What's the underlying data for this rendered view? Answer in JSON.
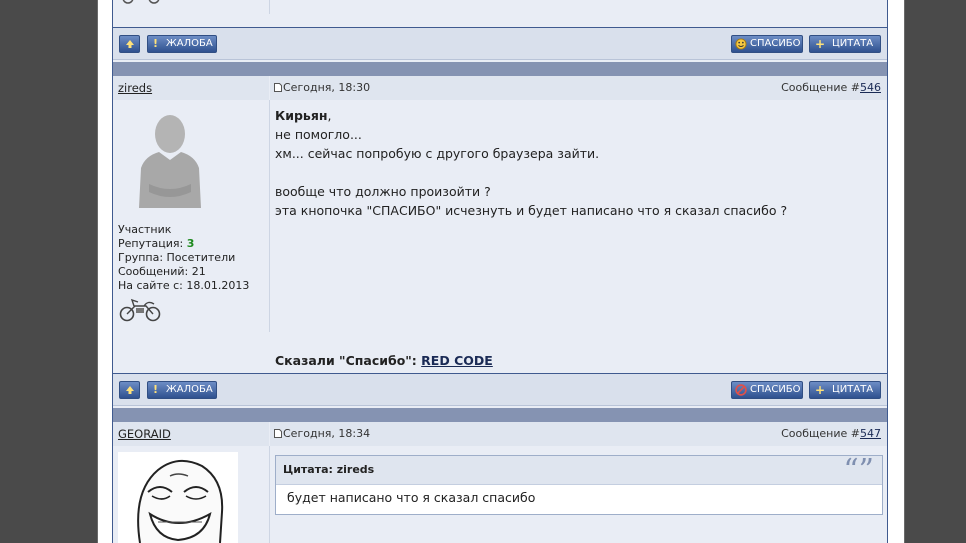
{
  "toolbar_top": {
    "up_label": "",
    "report_label": "ЖАЛОБА",
    "thanks_label": "СПАСИБО",
    "quote_label": "ЦИТАТА"
  },
  "post546": {
    "username": "zireds",
    "date": "Сегодня, 18:30",
    "number_prefix": "Сообщение #",
    "number": "546",
    "addressee": "Кирьян",
    "lines": [
      "не помогло...",
      "хм... сейчас попробую с другого браузера зайти.",
      "",
      "вообще что должно произойти ?",
      "эта кнопочка \"СПАСИБО\" исчезнуть и будет написано что я сказал спасибо ?"
    ],
    "user_info": {
      "role": "Участник",
      "reputation_label": "Репутация: ",
      "reputation_value": "3",
      "group": "Группа: Посетители",
      "messages": "Сообщений: 21",
      "joined": "На сайте с: 18.01.2013"
    },
    "thanks_prefix": "Сказали \"Спасибо\": ",
    "thanks_user": "RED CODE"
  },
  "toolbar_mid": {
    "report_label": "ЖАЛОБА",
    "thanks_label": "СПАСИБО",
    "quote_label": "ЦИТАТА"
  },
  "post547": {
    "username": "GEORAID",
    "date": "Сегодня, 18:34",
    "number_prefix": "Сообщение #",
    "number": "547",
    "quote_author": "Цитата: zireds",
    "quote_text": "будет написано что я сказал спасибо"
  },
  "colors": {
    "accent": "#3f5a8f",
    "button": "#2f518f",
    "reputation": "#1e8a1e",
    "separator": "#8593b2"
  }
}
